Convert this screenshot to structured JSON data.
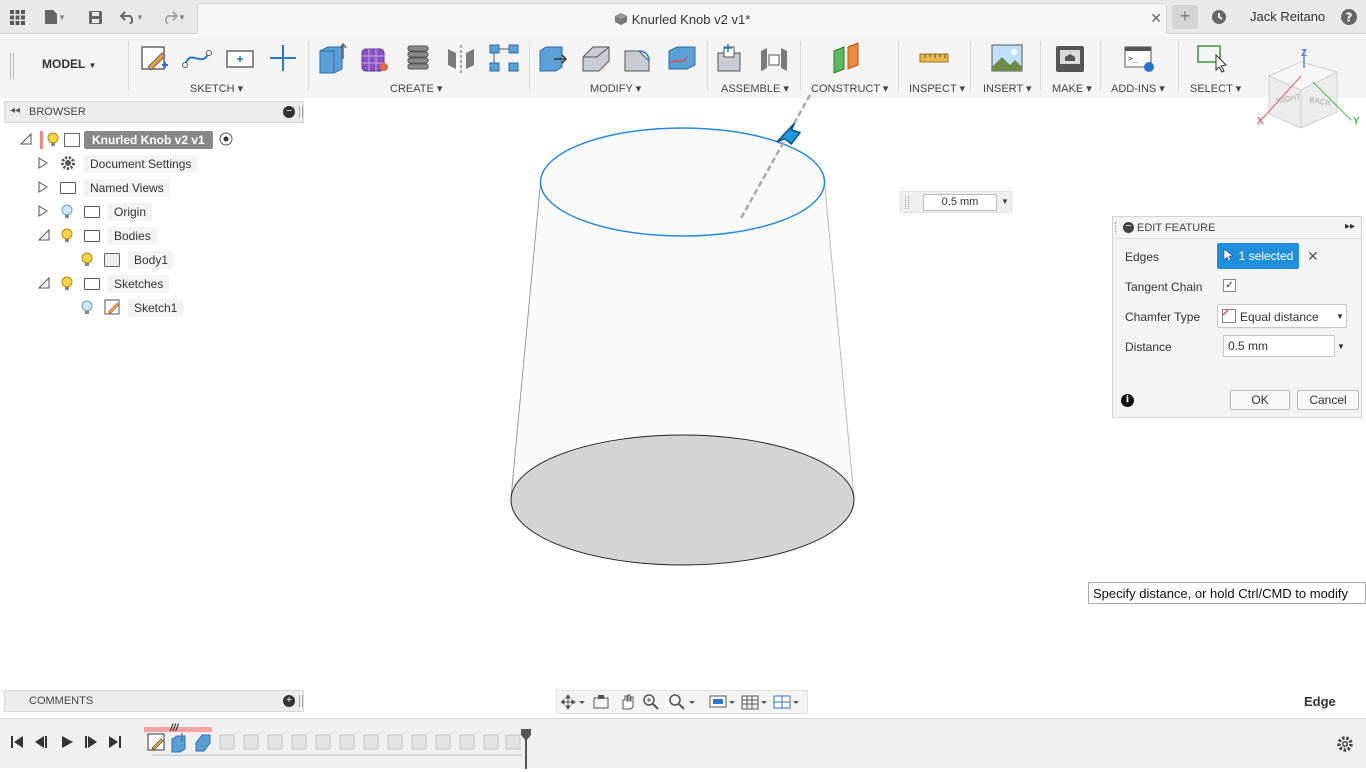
{
  "window": {
    "doc_title": "Knurled Knob v2 v1*",
    "user": "Jack Reitano"
  },
  "toolbar": {
    "workspace": "MODEL",
    "groups": [
      {
        "label": "SKETCH"
      },
      {
        "label": "CREATE"
      },
      {
        "label": "MODIFY"
      },
      {
        "label": "ASSEMBLE"
      },
      {
        "label": "CONSTRUCT"
      },
      {
        "label": "INSPECT"
      },
      {
        "label": "INSERT"
      },
      {
        "label": "MAKE"
      },
      {
        "label": "ADD-INS"
      },
      {
        "label": "SELECT"
      }
    ]
  },
  "viewcube": {
    "right": "RIGHT",
    "back": "BACK",
    "axis_z": "Z",
    "axis_x": "X",
    "axis_y": "Y"
  },
  "browser": {
    "title": "BROWSER",
    "root": "Knurled Knob v2 v1",
    "items": [
      {
        "label": "Document Settings"
      },
      {
        "label": "Named Views"
      },
      {
        "label": "Origin"
      },
      {
        "label": "Bodies"
      },
      {
        "label": "Body1"
      },
      {
        "label": "Sketches"
      },
      {
        "label": "Sketch1"
      }
    ]
  },
  "comments": {
    "title": "COMMENTS"
  },
  "viewport": {
    "distance_input": "0.5 mm",
    "selection_label": "Edge",
    "tooltip": "Specify distance, or hold Ctrl/CMD to modify"
  },
  "dialog": {
    "title": "EDIT FEATURE",
    "edges_label": "Edges",
    "edges_value": "1 selected",
    "tangent_label": "Tangent Chain",
    "tangent_checked": true,
    "chamfer_label": "Chamfer Type",
    "chamfer_value": "Equal distance",
    "distance_label": "Distance",
    "distance_value": "0.5 mm",
    "ok": "OK",
    "cancel": "Cancel"
  },
  "colors": {
    "selection_blue": "#1e8fd8",
    "edge_blue": "#2a88d8"
  }
}
